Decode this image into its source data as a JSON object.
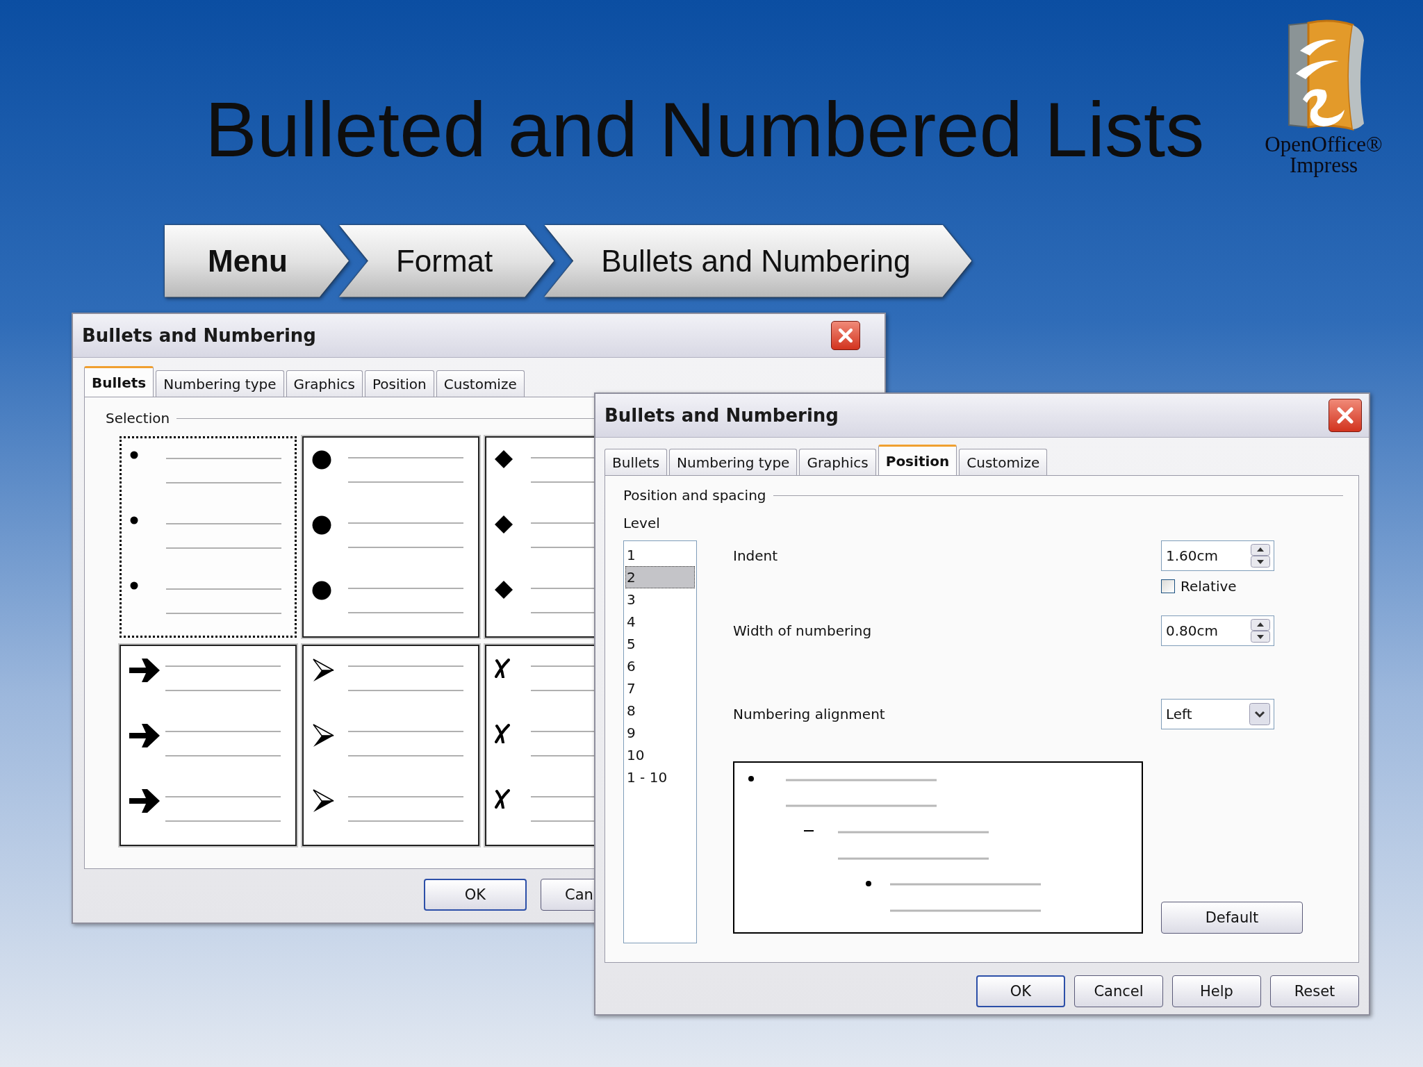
{
  "slide": {
    "title": "Bulleted and Numbered Lists",
    "logo_text": [
      "OpenOffice®",
      "Impress"
    ]
  },
  "breadcrumb": [
    {
      "label": "Menu",
      "bold": true
    },
    {
      "label": "Format",
      "bold": false
    },
    {
      "label": "Bullets and Numbering",
      "bold": false
    }
  ],
  "back_dialog": {
    "title": "Bullets and Numbering",
    "tabs": [
      {
        "label": "Bullets",
        "selected": true
      },
      {
        "label": "Numbering type",
        "selected": false
      },
      {
        "label": "Graphics",
        "selected": false
      },
      {
        "label": "Position",
        "selected": false
      },
      {
        "label": "Customize",
        "selected": false
      }
    ],
    "group_label": "Selection",
    "bullet_styles": [
      {
        "kind": "small-dot",
        "selected": true
      },
      {
        "kind": "large-dot",
        "selected": false
      },
      {
        "kind": "diamond",
        "selected": false
      },
      {
        "kind": "arrow",
        "selected": false
      },
      {
        "kind": "arrowhead",
        "selected": false
      },
      {
        "kind": "cross",
        "selected": false
      }
    ],
    "buttons": [
      {
        "label": "OK",
        "default": true
      },
      {
        "label": "Can",
        "default": false
      }
    ]
  },
  "front_dialog": {
    "title": "Bullets and Numbering",
    "tabs": [
      {
        "label": "Bullets",
        "selected": false
      },
      {
        "label": "Numbering type",
        "selected": false
      },
      {
        "label": "Graphics",
        "selected": false
      },
      {
        "label": "Position",
        "selected": true
      },
      {
        "label": "Customize",
        "selected": false
      }
    ],
    "group_label": "Position and spacing",
    "level_label": {
      "label": "Level"
    },
    "levels": [
      {
        "label": "1",
        "selected": false
      },
      {
        "label": "2",
        "selected": true
      },
      {
        "label": "3",
        "selected": false
      },
      {
        "label": "4",
        "selected": false
      },
      {
        "label": "5",
        "selected": false
      },
      {
        "label": "6",
        "selected": false
      },
      {
        "label": "7",
        "selected": false
      },
      {
        "label": "8",
        "selected": false
      },
      {
        "label": "9",
        "selected": false
      },
      {
        "label": "10",
        "selected": false
      },
      {
        "label": "1 - 10",
        "selected": false
      }
    ],
    "fields": [
      {
        "kind": "spin",
        "label": "Indent",
        "value": "1.60cm"
      },
      {
        "kind": "checkbox",
        "label": "Relative",
        "checked": false
      },
      {
        "kind": "spin",
        "label": "Width of numbering",
        "value": "0.80cm"
      },
      {
        "kind": "dropdown",
        "label": "Numbering alignment",
        "value": "Left"
      }
    ],
    "default_button": {
      "label": "Default"
    },
    "buttons": [
      {
        "label": "OK",
        "default": true
      },
      {
        "label": "Cancel",
        "default": false
      },
      {
        "label": "Help",
        "default": false
      },
      {
        "label": "Reset",
        "default": false
      }
    ]
  }
}
